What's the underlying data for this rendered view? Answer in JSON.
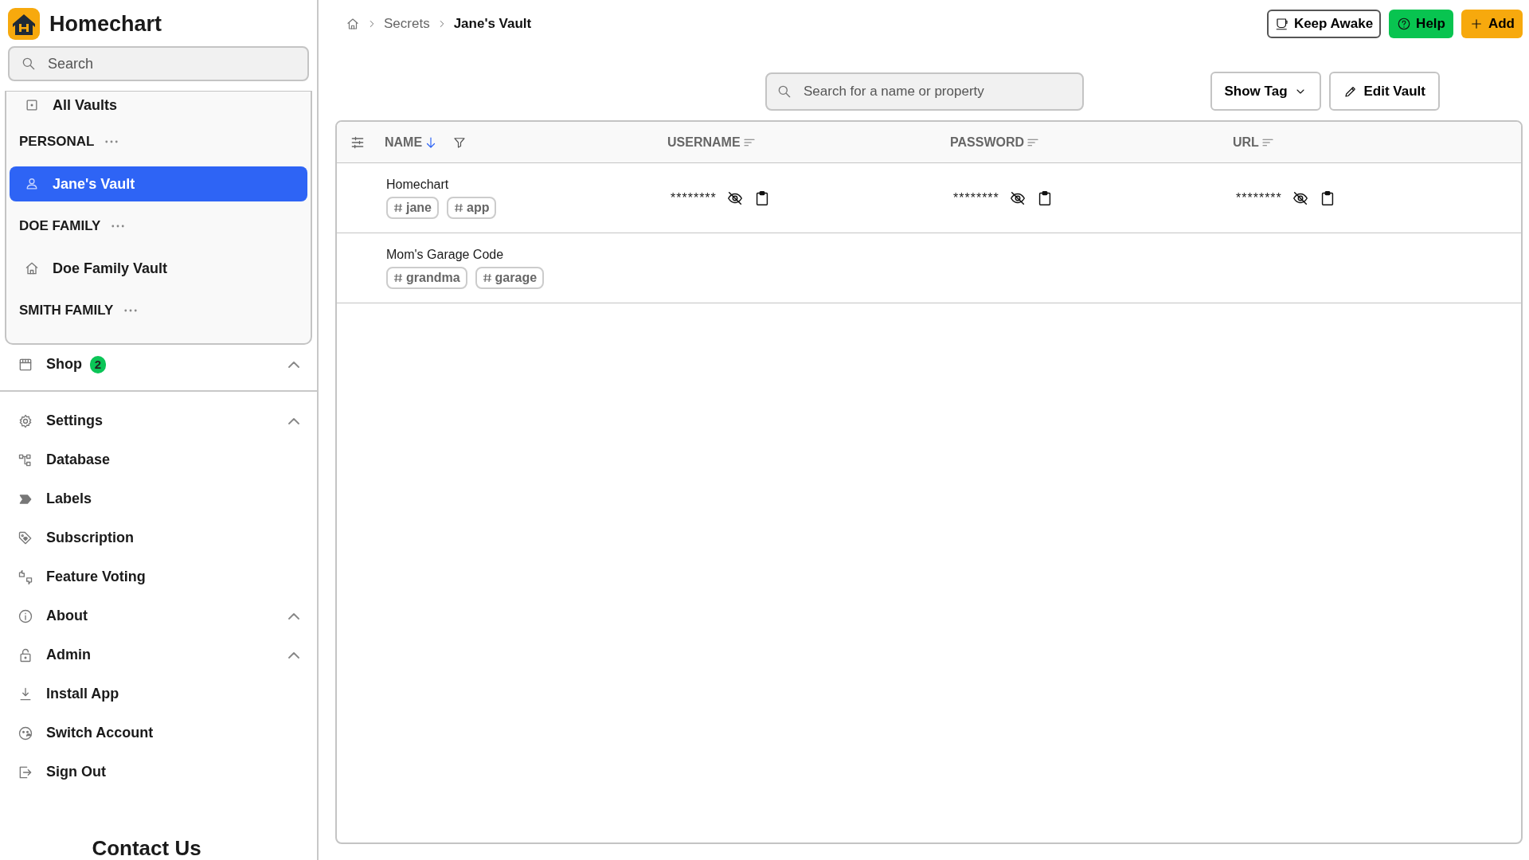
{
  "app": {
    "name": "Homechart"
  },
  "sidebar": {
    "search": {
      "placeholder": "Search"
    },
    "vaults": [
      {
        "kind": "vault",
        "label": "All Vaults",
        "selected": false
      },
      {
        "kind": "group",
        "label": "PERSONAL"
      },
      {
        "kind": "vault",
        "label": "Jane's Vault",
        "selected": true
      },
      {
        "kind": "group",
        "label": "DOE FAMILY"
      },
      {
        "kind": "vault",
        "label": "Doe Family Vault",
        "selected": false
      },
      {
        "kind": "group",
        "label": "SMITH FAMILY"
      }
    ],
    "nav": [
      {
        "kind": "section",
        "label": "Shop",
        "badge": "2",
        "expanded": true
      },
      {
        "kind": "divider"
      },
      {
        "kind": "section",
        "label": "Settings",
        "expanded": true
      },
      {
        "kind": "link",
        "label": "Database"
      },
      {
        "kind": "link",
        "label": "Labels"
      },
      {
        "kind": "link",
        "label": "Subscription"
      },
      {
        "kind": "link",
        "label": "Feature Voting"
      },
      {
        "kind": "section",
        "label": "About",
        "expanded": true
      },
      {
        "kind": "section",
        "label": "Admin",
        "expanded": true
      },
      {
        "kind": "link",
        "label": "Install App"
      },
      {
        "kind": "link",
        "label": "Switch Account"
      },
      {
        "kind": "link",
        "label": "Sign Out"
      }
    ],
    "footer": "Contact Us"
  },
  "breadcrumb": [
    "Secrets",
    "Jane's Vault"
  ],
  "actions": [
    {
      "kind": "outline",
      "label": "Keep Awake"
    },
    {
      "kind": "green",
      "label": "Help"
    },
    {
      "kind": "orange",
      "label": "Add"
    }
  ],
  "toolbar": {
    "search": {
      "placeholder": "Search for a name or property"
    },
    "buttons": [
      {
        "kind": "dropdown",
        "label": "Show Tag"
      },
      {
        "kind": "edit",
        "label": "Edit Vault"
      }
    ]
  },
  "table": {
    "columns": [
      {
        "label": "NAME",
        "sorted": true
      },
      {
        "label": "USERNAME",
        "sorted": false
      },
      {
        "label": "PASSWORD",
        "sorted": false
      },
      {
        "label": "URL",
        "sorted": false
      }
    ],
    "rows": [
      {
        "name": "Homechart",
        "tags": [
          "jane",
          "app"
        ],
        "username": "********",
        "password": "********",
        "url": "********"
      },
      {
        "name": "Mom's Garage Code",
        "tags": [
          "grandma",
          "garage"
        ]
      }
    ]
  }
}
